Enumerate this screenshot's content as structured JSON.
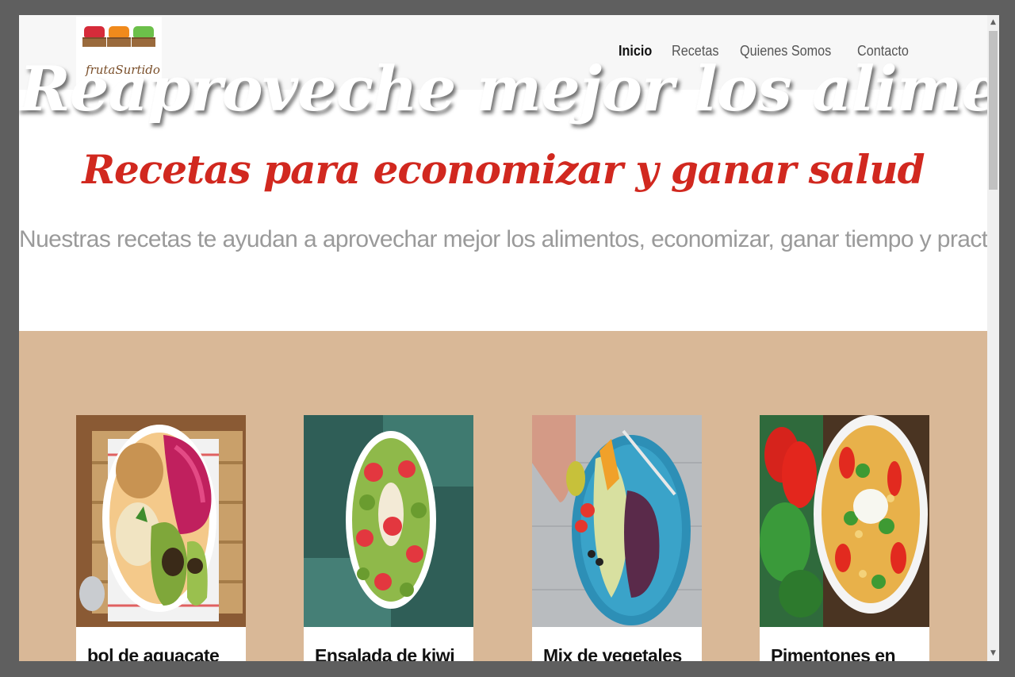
{
  "logo": {
    "text": "frutaSurtido"
  },
  "nav": {
    "items": [
      "Inicio",
      "Recetas",
      "Quienes Somos",
      "Contacto"
    ],
    "active": "Inicio"
  },
  "hero": {
    "title": "Reaproveche mejor los alimentos",
    "subtitle": "Recetas para economizar y ganar salud",
    "description": "Nuestras recetas te ayudan a aprovechar mejor los alimentos, economizar, ganar tiempo y practicidad"
  },
  "cards": [
    {
      "title": "bol de aguacate"
    },
    {
      "title": "Ensalada de kiwi"
    },
    {
      "title": "Mix de vegetales"
    },
    {
      "title": "Pimentones en"
    }
  ],
  "colors": {
    "accent_red": "#d1281f",
    "section_bg": "#d9b897",
    "header_bg": "#f7f7f7"
  }
}
